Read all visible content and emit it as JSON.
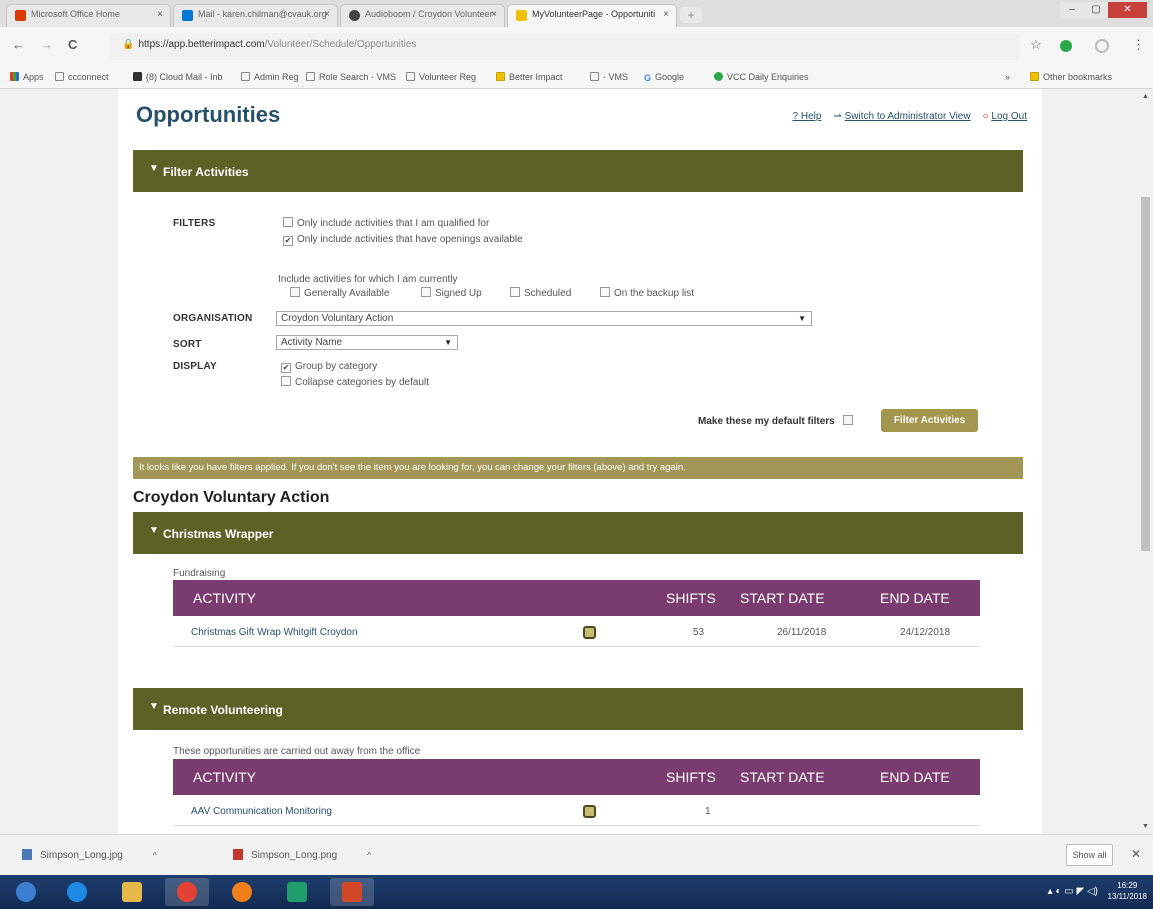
{
  "browser": {
    "tabs": [
      {
        "label": "Microsoft Office Home",
        "color": "#d83b01"
      },
      {
        "label": "Mail - karen.chilman@cvauk.org",
        "color": "#0078d4"
      },
      {
        "label": "Audioboom / Croydon Volunteer",
        "color": "#444444"
      },
      {
        "label": "MyVolunteerPage - Opportuniti",
        "color": "#f0c000"
      }
    ],
    "tab_close": "×",
    "new_tab": "+",
    "window_controls": [
      "–",
      "▢",
      "✕"
    ],
    "nav": {
      "back": "←",
      "forward": "→",
      "reload": "C"
    },
    "url_lock": "🔒",
    "url_host": "https://app.betterimpact.com",
    "url_path": "/Volunteer/Schedule/Opportunities",
    "star": "☆",
    "menu": "⋮",
    "bookmarks": [
      "Apps",
      "ccconnect",
      "(8) Cloud Mail - Inb",
      "Admin Reg",
      "Role Search - VMS",
      "Volunteer Reg",
      "Better Impact",
      "- VMS",
      "Google",
      "VCC Daily Enquiries"
    ],
    "bookmarks_more": "»",
    "other_bookmarks": "Other bookmarks"
  },
  "header": {
    "title": "Opportunities",
    "help": "? Help",
    "switch_view": "Switch to Administrator View",
    "logout": "Log Out"
  },
  "filters": {
    "panel_title": "Filter Activities",
    "label_filters": "FILTERS",
    "opt_qualified": "Only include activities that I am qualified for",
    "opt_openings": "Only include activities that have openings available",
    "include_prompt": "Include activities for which I am currently",
    "status_options": [
      "Generally Available",
      "Signed Up",
      "Scheduled",
      "On the backup list"
    ],
    "label_org": "ORGANISATION",
    "org_value": "Croydon Voluntary Action",
    "label_sort": "SORT",
    "sort_value": "Activity Name",
    "label_display": "DISPLAY",
    "opt_group": "Group by category",
    "opt_collapse": "Collapse categories by default",
    "default_label": "Make these my default filters",
    "button": "Filter Activities",
    "checked_mark": "✔"
  },
  "notice": "It looks like you have filters applied. If you don't see the item you are looking for, you can change your filters (above) and try again.",
  "organisation_title": "Croydon Voluntary Action",
  "table_headers": {
    "activity": "ACTIVITY",
    "shifts": "SHIFTS",
    "start": "START DATE",
    "end": "END DATE"
  },
  "categories": [
    {
      "name": "Christmas Wrapper",
      "description": "Fundraising",
      "rows": [
        {
          "activity": "Christmas Gift Wrap Whitgift Croydon",
          "shifts": "53",
          "start": "26/11/2018",
          "end": "24/12/2018"
        }
      ]
    },
    {
      "name": "Remote Volunteering",
      "description": "These opportunities are carried out away from the office",
      "rows": [
        {
          "activity": "AAV Communication Monitoring",
          "shifts": "1",
          "start": "",
          "end": ""
        }
      ]
    }
  ],
  "downloads": [
    "Simpson_Long.jpg",
    "Simpson_Long.png"
  ],
  "download_chevron": "^",
  "show_all": "Show all",
  "download_close": "✕",
  "taskbar": {
    "apps": [
      {
        "name": "start",
        "color": "#3a7fd0"
      },
      {
        "name": "internet-explorer",
        "color": "#1e88e5"
      },
      {
        "name": "file-explorer",
        "color": "#e6b84a"
      },
      {
        "name": "chrome",
        "color": "#e34133"
      },
      {
        "name": "firefox",
        "color": "#f07f1a"
      },
      {
        "name": "publisher",
        "color": "#1f9d6a"
      },
      {
        "name": "powerpoint",
        "color": "#d24726"
      }
    ],
    "tray": "▴  ◐  ▭  ◤  ◁)",
    "time": "16:29",
    "date": "13/11/2018"
  }
}
